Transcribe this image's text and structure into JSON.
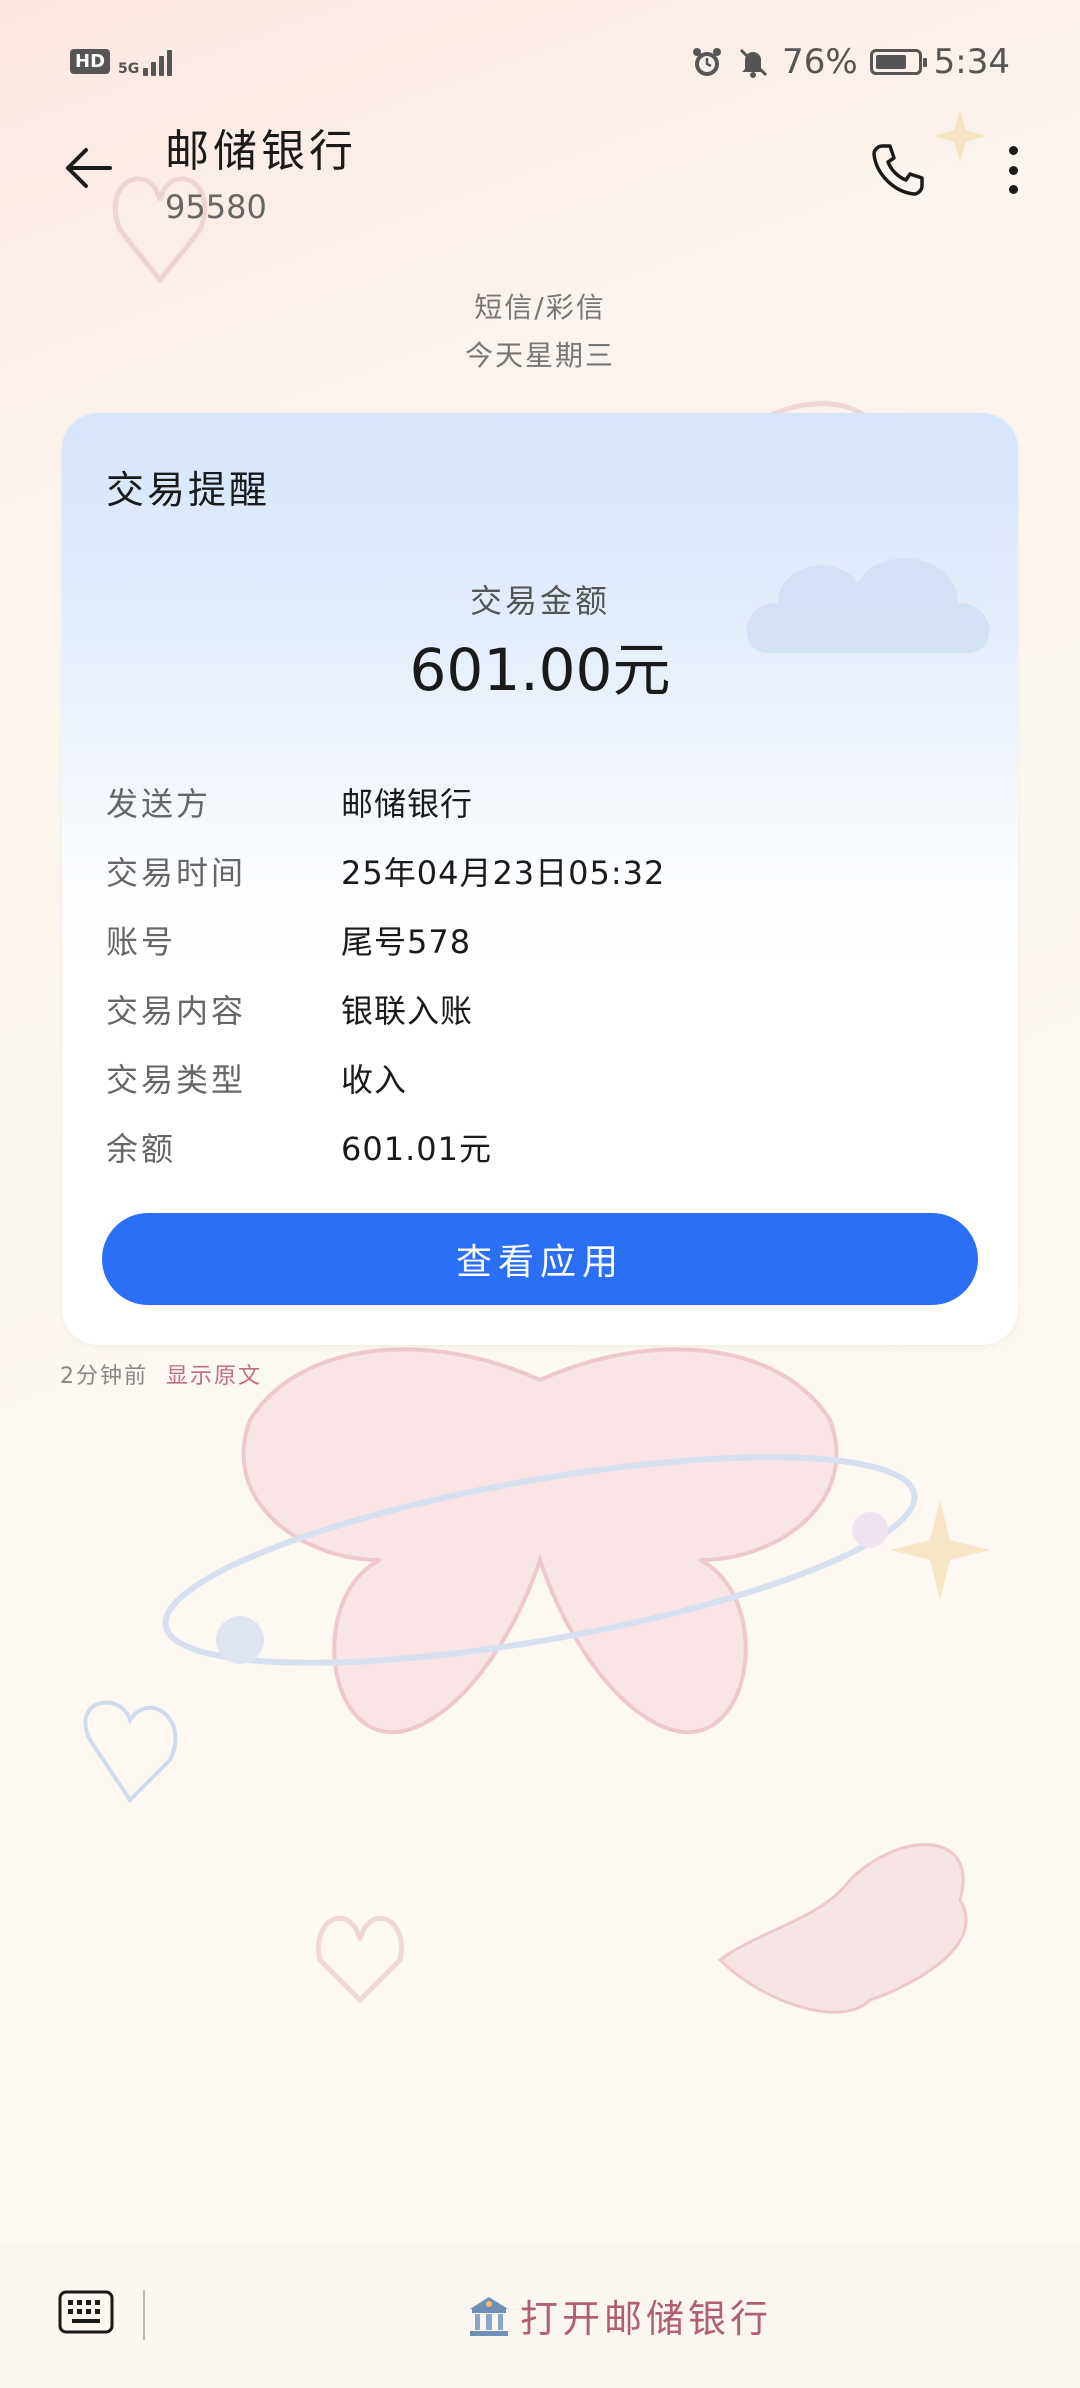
{
  "status_bar": {
    "hd": "HD",
    "network": "5G",
    "battery_percent": "76%",
    "battery_level": 0.76,
    "time": "5:34"
  },
  "header": {
    "title": "邮储银行",
    "number": "95580"
  },
  "meta": {
    "type": "短信/彩信",
    "date": "今天星期三"
  },
  "card": {
    "title": "交易提醒",
    "amount_label": "交易金额",
    "amount_value": "601.00元",
    "rows": [
      {
        "key": "发送方",
        "value": "邮储银行"
      },
      {
        "key": "交易时间",
        "value": "25年04月23日05:32"
      },
      {
        "key": "账号",
        "value": "尾号578"
      },
      {
        "key": "交易内容",
        "value": "银联入账"
      },
      {
        "key": "交易类型",
        "value": "收入"
      },
      {
        "key": "余额",
        "value": "601.01元"
      }
    ],
    "button_label": "查看应用"
  },
  "footer": {
    "time_ago": "2分钟前",
    "show_original": "显示原文"
  },
  "bottom_bar": {
    "open_app_label": "打开邮储银行"
  },
  "colors": {
    "accent": "#2a6ff5",
    "link": "#c0707a"
  }
}
